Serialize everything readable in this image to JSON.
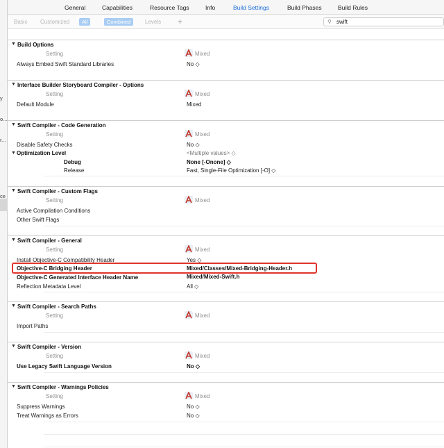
{
  "tabs": [
    "General",
    "Capabilities",
    "Resource Tags",
    "Info",
    "Build Settings",
    "Build Phases",
    "Build Rules"
  ],
  "active_tab": "Build Settings",
  "filter": {
    "basic": "Basic",
    "customized": "Customized",
    "all": "All",
    "combined": "Combined",
    "levels": "Levels",
    "add": "+"
  },
  "search": {
    "value": "swift"
  },
  "nav_fragments": [
    "y",
    "o...",
    "r...",
    "ce"
  ],
  "common": {
    "setting": "Setting",
    "mixed": "Mixed"
  },
  "sections": [
    {
      "title": "Build Options",
      "rows": [
        {
          "label": "Always Embed Swift Standard Libraries",
          "value": "No ◇"
        }
      ]
    },
    {
      "title": "Interface Builder Storyboard Compiler - Options",
      "rows": [
        {
          "label": "Default Module",
          "value": "Mixed"
        }
      ]
    },
    {
      "title": "Swift Compiler - Code Generation",
      "rows": [
        {
          "label": "Disable Safety Checks",
          "value": "No ◇"
        },
        {
          "label": "Optimization Level",
          "value": "<Multiple values> ◇"
        },
        {
          "label": "Debug",
          "value": "None [-Onone] ◇"
        },
        {
          "label": "Release",
          "value": "Fast, Single-File Optimization [-O] ◇"
        }
      ]
    },
    {
      "title": "Swift Compiler - Custom Flags",
      "rows": [
        {
          "label": "Active Compilation Conditions",
          "value": ""
        },
        {
          "label": "Other Swift Flags",
          "value": ""
        }
      ]
    },
    {
      "title": "Swift Compiler - General",
      "rows": [
        {
          "label": "Install Objective-C Compatibility Header",
          "value": "Yes ◇"
        },
        {
          "label": "Objective-C Bridging Header",
          "value": "Mixed/Classes/Mixed-Bridging-Header.h"
        },
        {
          "label": "Objective-C Generated Interface Header Name",
          "value": "Mixed/Mixed-Swift.h"
        },
        {
          "label": "Reflection Metadata Level",
          "value": "All ◇"
        }
      ]
    },
    {
      "title": "Swift Compiler - Search Paths",
      "rows": [
        {
          "label": "Import Paths",
          "value": ""
        }
      ]
    },
    {
      "title": "Swift Compiler - Version",
      "rows": [
        {
          "label": "Use Legacy Swift Language Version",
          "value": "No ◇"
        }
      ]
    },
    {
      "title": "Swift Compiler - Warnings Policies",
      "rows": [
        {
          "label": "Suppress Warnings",
          "value": "No ◇"
        },
        {
          "label": "Treat Warnings as Errors",
          "value": "No ◇"
        }
      ]
    }
  ],
  "colors": {
    "accent": "#1f6fd8",
    "highlight": "#e0342c",
    "pill": "#a9cdf3"
  }
}
